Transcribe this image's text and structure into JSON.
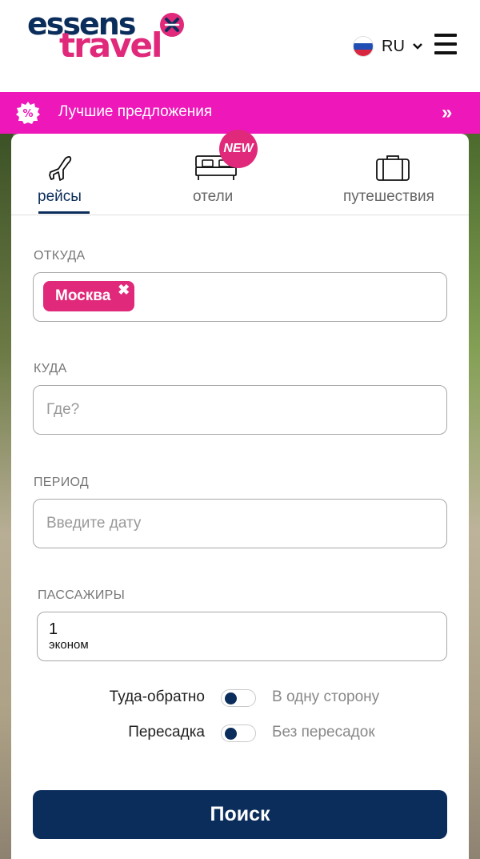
{
  "header": {
    "logo_top": "essens",
    "logo_bottom": "travel",
    "language": "RU"
  },
  "deals": {
    "label": "Лучшие предложения",
    "arrows": "»"
  },
  "tabs": [
    {
      "label": "рейсы",
      "icon": "plane-icon",
      "active": true
    },
    {
      "label": "отели",
      "icon": "bed-icon",
      "badge": "NEW"
    },
    {
      "label": "путешествия",
      "icon": "suitcase-icon"
    }
  ],
  "form": {
    "from": {
      "label": "ОТКУДА",
      "chip": "Москва"
    },
    "to": {
      "label": "КУДА",
      "placeholder": "Где?"
    },
    "period": {
      "label": "ПЕРИОД",
      "placeholder": "Введите дату"
    },
    "passengers": {
      "label": "ПАССАЖИРЫ",
      "count": "1",
      "class": "эконом"
    },
    "trip_type": {
      "left": "Туда-обратно",
      "right": "В одну сторону"
    },
    "transfer": {
      "left": "Пересадка",
      "right": "Без пересадок"
    },
    "search_label": "Поиск"
  },
  "colors": {
    "navy": "#0b2d5b",
    "pink": "#e0297a",
    "magenta": "#ee17b9"
  }
}
